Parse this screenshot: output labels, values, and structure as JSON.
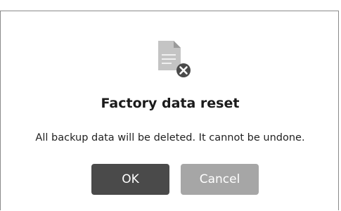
{
  "dialog": {
    "icon": "document-delete-icon",
    "title": "Factory data reset",
    "message": "All backup data will be deleted. It cannot be undone.",
    "ok_label": "OK",
    "cancel_label": "Cancel"
  },
  "colors": {
    "ok_button": "#4a4a4a",
    "cancel_button": "#a6a6a6",
    "icon_gray": "#bfbfbf",
    "badge": "#4a4a4a"
  }
}
